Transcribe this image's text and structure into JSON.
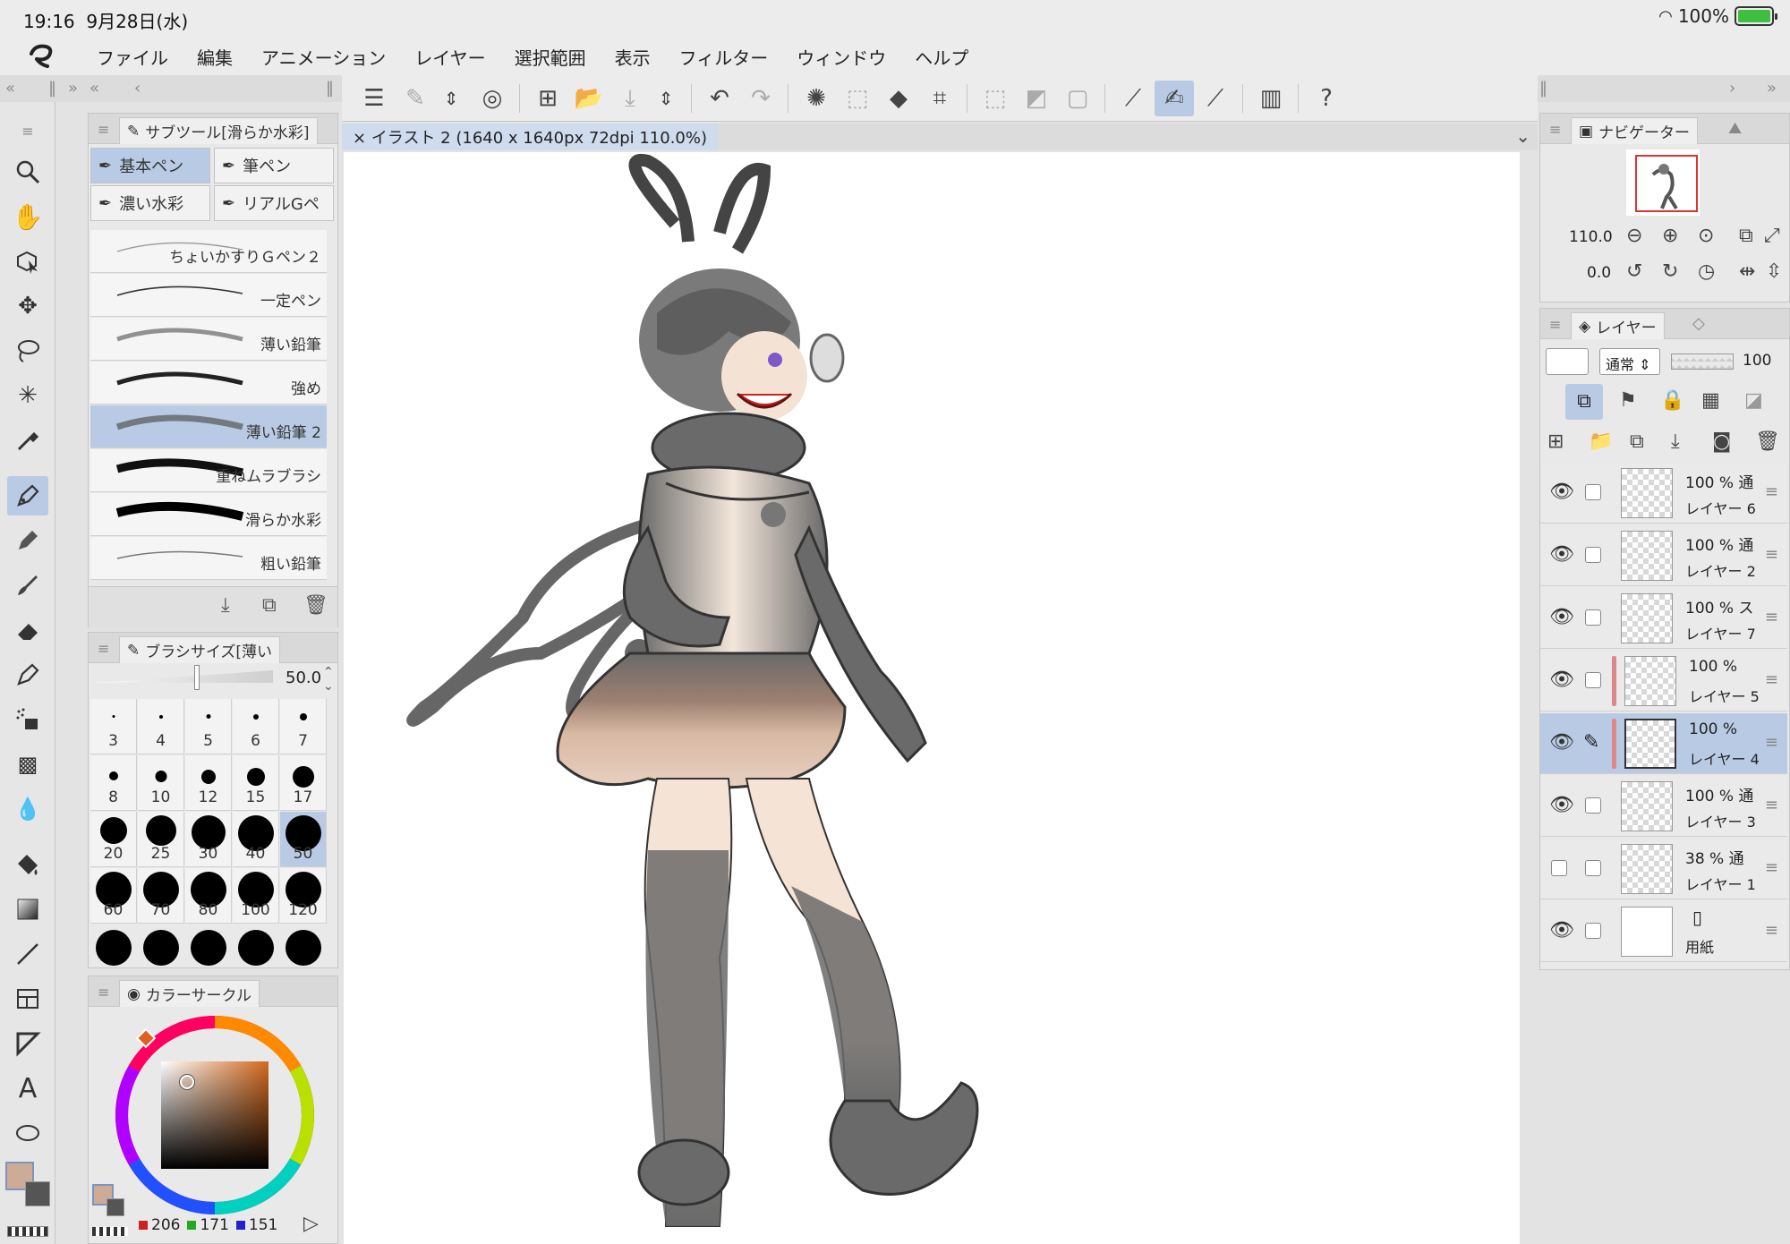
{
  "status_bar": {
    "time": "19:16",
    "date": "9月28日(水)",
    "battery": "100%"
  },
  "menu": [
    "ファイル",
    "編集",
    "アニメーション",
    "レイヤー",
    "選択範囲",
    "表示",
    "フィルター",
    "ウィンドウ",
    "ヘルプ"
  ],
  "document": {
    "tab_label": "× イラスト 2 (1640 x 1640px 72dpi 110.0%)"
  },
  "subtool": {
    "tab": "サブツール[滑らか水彩]",
    "presets": [
      "基本ペン",
      "筆ペン",
      "濃い水彩",
      "リアルGペ"
    ],
    "brushes": [
      "ちょいかすりＧペン２",
      "一定ペン",
      "薄い鉛筆",
      "強め",
      "薄い鉛筆 2",
      "重ねムラブラシ",
      "滑らか水彩",
      "粗い鉛筆"
    ],
    "selected_brush": "薄い鉛筆 2"
  },
  "brush_size": {
    "tab": "ブラシサイズ[薄い",
    "value": "50.0",
    "sizes": [
      "3",
      "4",
      "5",
      "6",
      "7",
      "8",
      "10",
      "12",
      "15",
      "17",
      "20",
      "25",
      "30",
      "40",
      "50",
      "60",
      "70",
      "80",
      "100",
      "120"
    ],
    "selected": "50"
  },
  "color": {
    "tab": "カラーサークル",
    "r": "206",
    "g": "171",
    "b": "151",
    "main_color": "#ceab97",
    "sub_color": "#555555"
  },
  "navigator": {
    "tab": "ナビゲーター",
    "zoom": "110.0",
    "rotation": "0.0"
  },
  "layers": {
    "tab": "レイヤー",
    "blend_mode": "通常",
    "opacity": "100",
    "items": [
      {
        "opacity": "100 %",
        "mode": "通",
        "name": "レイヤー 6"
      },
      {
        "opacity": "100 %",
        "mode": "通",
        "name": "レイヤー 2"
      },
      {
        "opacity": "100 %",
        "mode": "ス",
        "name": "レイヤー 7"
      },
      {
        "opacity": "100 %",
        "mode": "",
        "name": "レイヤー 5"
      },
      {
        "opacity": "100 %",
        "mode": "",
        "name": "レイヤー 4"
      },
      {
        "opacity": "100 %",
        "mode": "通",
        "name": "レイヤー 3"
      },
      {
        "opacity": "38 %",
        "mode": "通",
        "name": "レイヤー 1"
      },
      {
        "opacity": "",
        "mode": "",
        "name": "用紙"
      }
    ]
  }
}
